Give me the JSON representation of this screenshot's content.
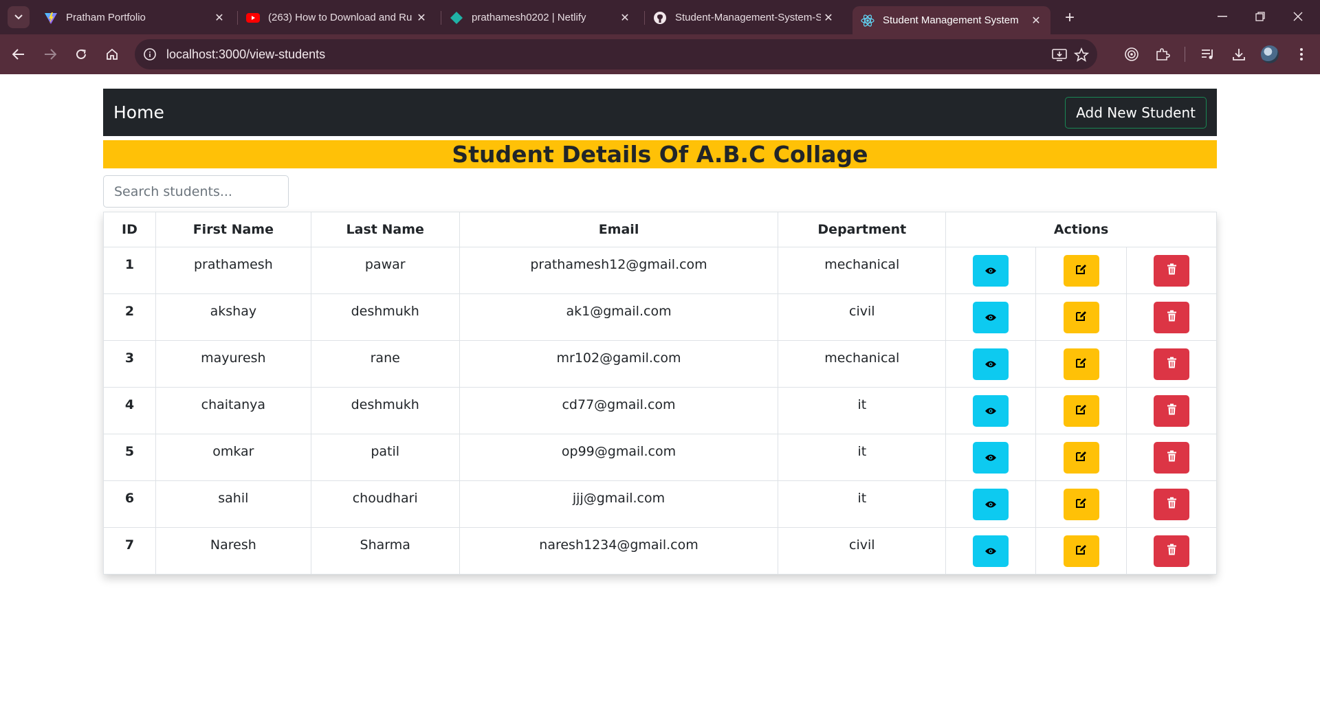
{
  "browser": {
    "tabs": [
      {
        "title": "Pratham Portfolio",
        "icon": "vite-icon"
      },
      {
        "title": "(263) How to Download and Ru",
        "icon": "youtube-icon"
      },
      {
        "title": "prathamesh0202 | Netlify",
        "icon": "netlify-icon"
      },
      {
        "title": "Student-Management-System-S",
        "icon": "github-icon"
      },
      {
        "title": "Student Management System",
        "icon": "react-icon"
      }
    ],
    "active_tab": 4,
    "url": "localhost:3000/view-students"
  },
  "navbar": {
    "brand": "Home",
    "add_button": "Add New Student"
  },
  "banner": {
    "title": "Student Details Of A.B.C Collage"
  },
  "search": {
    "placeholder": "Search students..."
  },
  "table": {
    "headers": {
      "id": "ID",
      "first_name": "First Name",
      "last_name": "Last Name",
      "email": "Email",
      "department": "Department",
      "actions": "Actions"
    },
    "rows": [
      {
        "id": "1",
        "first_name": "prathamesh",
        "last_name": "pawar",
        "email": "prathamesh12@gmail.com",
        "department": "mechanical"
      },
      {
        "id": "2",
        "first_name": "akshay",
        "last_name": "deshmukh",
        "email": "ak1@gmail.com",
        "department": "civil"
      },
      {
        "id": "3",
        "first_name": "mayuresh",
        "last_name": "rane",
        "email": "mr102@gamil.com",
        "department": "mechanical"
      },
      {
        "id": "4",
        "first_name": "chaitanya",
        "last_name": "deshmukh",
        "email": "cd77@gmail.com",
        "department": "it"
      },
      {
        "id": "5",
        "first_name": "omkar",
        "last_name": "patil",
        "email": "op99@gmail.com",
        "department": "it"
      },
      {
        "id": "6",
        "first_name": "sahil",
        "last_name": "choudhari",
        "email": "jjj@gmail.com",
        "department": "it"
      },
      {
        "id": "7",
        "first_name": "Naresh",
        "last_name": "Sharma",
        "email": "naresh1234@gmail.com",
        "department": "civil"
      }
    ],
    "action_icons": [
      "eye-icon",
      "edit-icon",
      "trash-icon"
    ]
  },
  "colors": {
    "navbar_bg": "#212529",
    "banner_bg": "#ffc107",
    "view_btn": "#0dcaf0",
    "edit_btn": "#ffc107",
    "delete_btn": "#dc3545",
    "add_btn_border": "#198754"
  }
}
